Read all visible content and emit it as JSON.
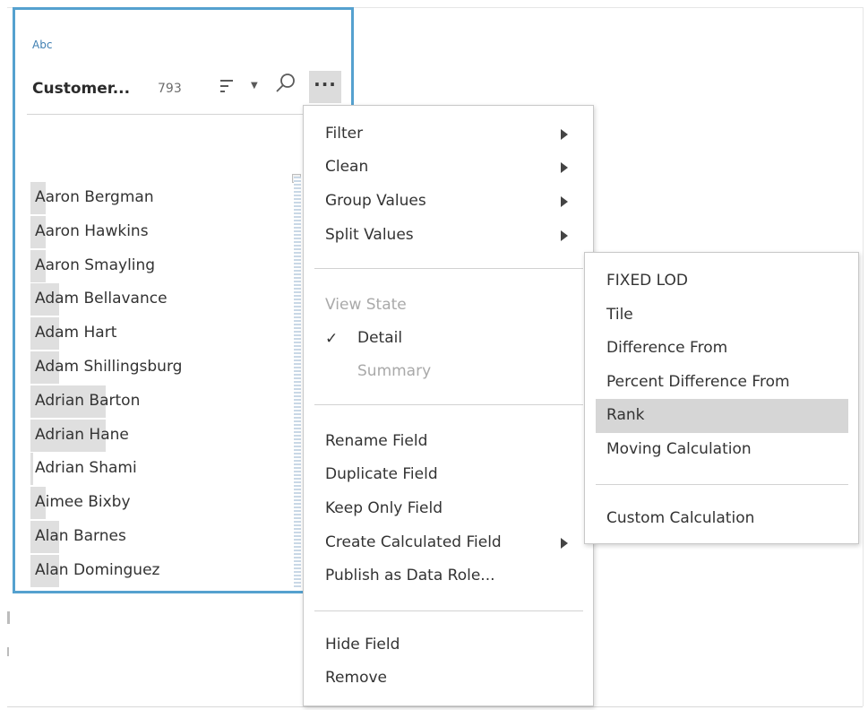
{
  "field_card": {
    "type_label": "Abc",
    "field_name": "Customer...",
    "value_count": "793",
    "more_button_label": "···",
    "values": [
      {
        "name": "Aaron Bergman",
        "level": 0.06
      },
      {
        "name": "Aaron Hawkins",
        "level": 0.06
      },
      {
        "name": "Aaron Smayling",
        "level": 0.06
      },
      {
        "name": "Adam Bellavance",
        "level": 0.11
      },
      {
        "name": "Adam Hart",
        "level": 0.11
      },
      {
        "name": "Adam Shillingsburg",
        "level": 0.11
      },
      {
        "name": "Adrian Barton",
        "level": 0.29
      },
      {
        "name": "Adrian Hane",
        "level": 0.29
      },
      {
        "name": "Adrian Shami",
        "level": 0.01
      },
      {
        "name": "Aimee Bixby",
        "level": 0.06
      },
      {
        "name": "Alan Barnes",
        "level": 0.11
      },
      {
        "name": "Alan Dominguez",
        "level": 0.11
      }
    ]
  },
  "main_menu": {
    "submenu_items": [
      {
        "label": "Filter",
        "has_submenu": true
      },
      {
        "label": "Clean",
        "has_submenu": true
      },
      {
        "label": "Group Values",
        "has_submenu": true
      },
      {
        "label": "Split Values",
        "has_submenu": true
      }
    ],
    "view_state": {
      "header": "View State",
      "check_mark": "✓",
      "detail_label": "Detail",
      "summary_label": "Summary"
    },
    "field_actions": [
      {
        "label": "Rename Field",
        "has_submenu": false
      },
      {
        "label": "Duplicate Field",
        "has_submenu": false
      },
      {
        "label": "Keep Only Field",
        "has_submenu": false
      },
      {
        "label": "Create Calculated Field",
        "has_submenu": true
      },
      {
        "label": "Publish as Data Role...",
        "has_submenu": false
      }
    ],
    "final_actions": [
      {
        "label": "Hide Field"
      },
      {
        "label": "Remove"
      }
    ]
  },
  "calc_submenu": {
    "items": [
      {
        "label": "FIXED LOD",
        "highlighted": false
      },
      {
        "label": "Tile",
        "highlighted": false
      },
      {
        "label": "Difference From",
        "highlighted": false
      },
      {
        "label": "Percent Difference From",
        "highlighted": false
      },
      {
        "label": "Rank",
        "highlighted": true
      },
      {
        "label": "Moving Calculation",
        "highlighted": false
      }
    ],
    "custom_item": {
      "label": "Custom Calculation"
    }
  },
  "colors": {
    "card_border": "#55a1cf",
    "highlight": "#d6d6d6",
    "value_bar": "#dfdfdf",
    "disabled_text": "#a9a9a9"
  },
  "icons": {
    "sort": "sort-icon",
    "dropdown": "chevron-down-icon",
    "search": "search-icon",
    "more": "more-options-icon",
    "submenu": "chevron-right-icon",
    "check": "checkmark-icon"
  }
}
